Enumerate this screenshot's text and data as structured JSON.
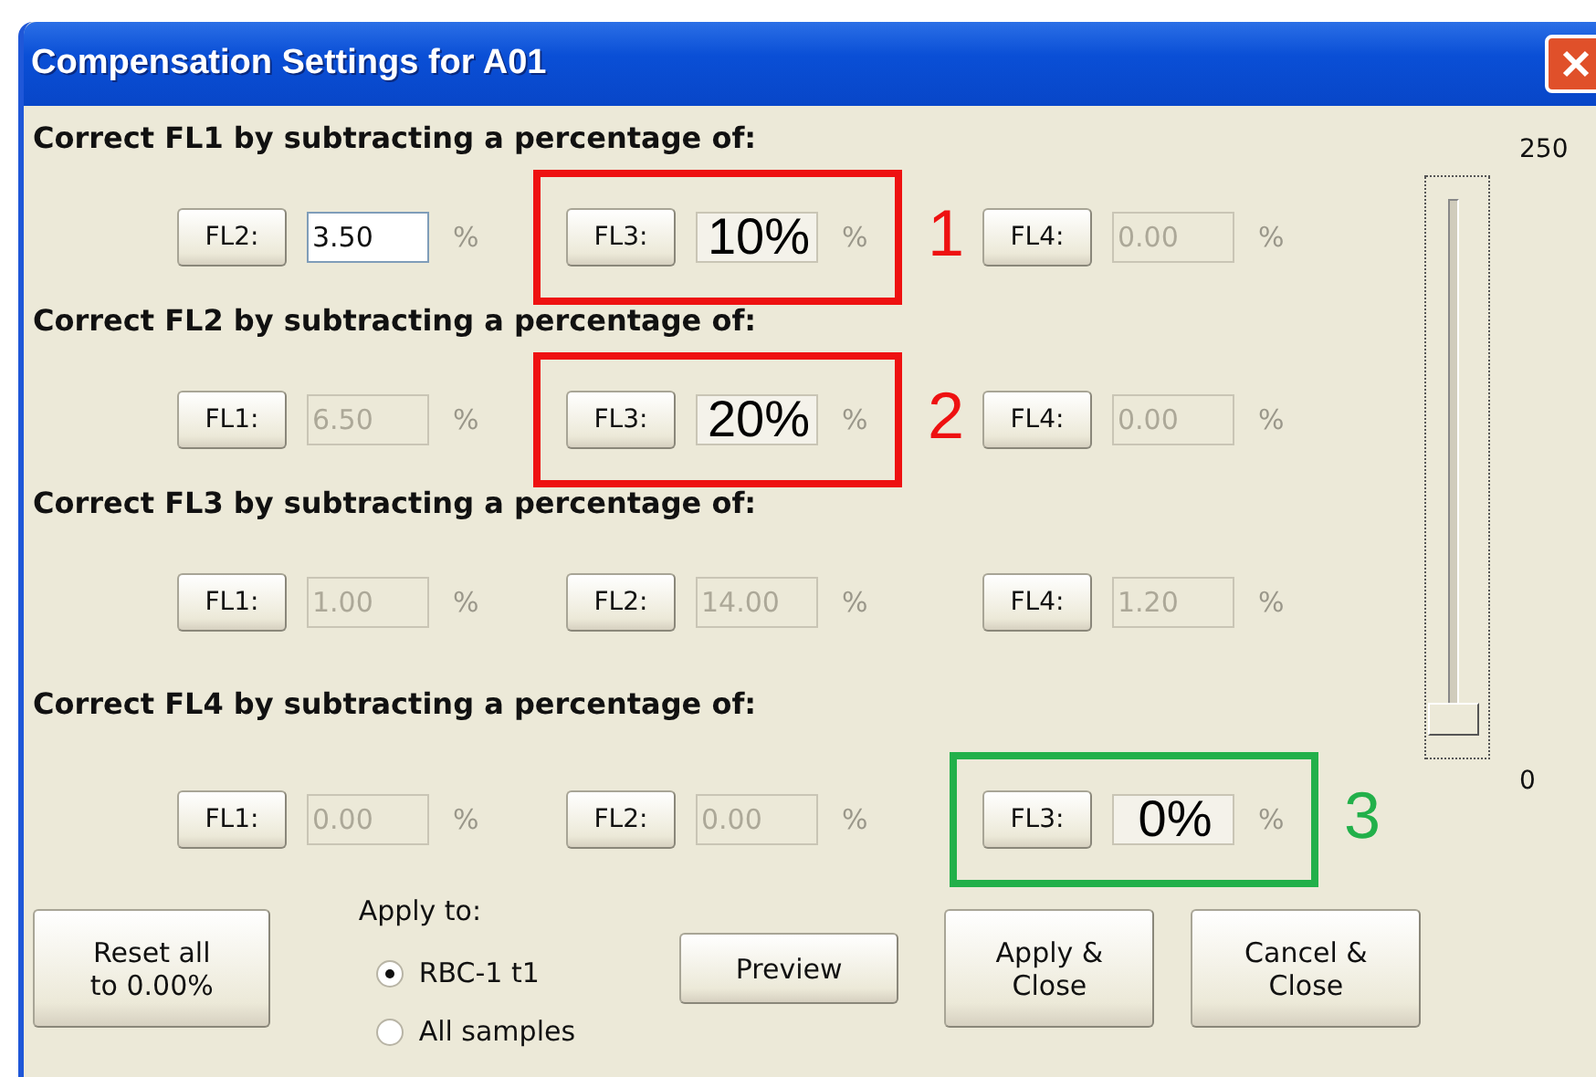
{
  "window": {
    "title": "Compensation Settings for A01"
  },
  "sections": [
    {
      "heading": "Correct FL1 by subtracting a percentage of:",
      "items": [
        {
          "button": "FL2:",
          "value": "3.50",
          "unit": "%",
          "disabled": false
        },
        {
          "button": "FL3:",
          "value": "10%",
          "unit": "%",
          "disabled": true,
          "annotation": {
            "label": "1",
            "color": "#ee1111"
          }
        },
        {
          "button": "FL4:",
          "value": "0.00",
          "unit": "%",
          "disabled": true
        }
      ]
    },
    {
      "heading": "Correct FL2 by subtracting a percentage of:",
      "items": [
        {
          "button": "FL1:",
          "value": "6.50",
          "unit": "%",
          "disabled": true
        },
        {
          "button": "FL3:",
          "value": "20%",
          "unit": "%",
          "disabled": true,
          "annotation": {
            "label": "2",
            "color": "#ee1111"
          }
        },
        {
          "button": "FL4:",
          "value": "0.00",
          "unit": "%",
          "disabled": true
        }
      ]
    },
    {
      "heading": "Correct FL3 by subtracting a percentage of:",
      "items": [
        {
          "button": "FL1:",
          "value": "1.00",
          "unit": "%",
          "disabled": true
        },
        {
          "button": "FL2:",
          "value": "14.00",
          "unit": "%",
          "disabled": true
        },
        {
          "button": "FL4:",
          "value": "1.20",
          "unit": "%",
          "disabled": true
        }
      ]
    },
    {
      "heading": "Correct FL4 by subtracting a percentage of:",
      "items": [
        {
          "button": "FL1:",
          "value": "0.00",
          "unit": "%",
          "disabled": true
        },
        {
          "button": "FL2:",
          "value": "0.00",
          "unit": "%",
          "disabled": true
        },
        {
          "button": "FL3:",
          "value": "0%",
          "unit": "%",
          "disabled": true,
          "annotation": {
            "label": "3",
            "color": "#22b04a"
          }
        }
      ]
    }
  ],
  "slider": {
    "max_label": "250",
    "min_label": "0",
    "level": 0
  },
  "reset_button": "Reset all\nto 0.00%",
  "apply_to": {
    "label": "Apply to:",
    "options": [
      {
        "label": "RBC-1 t1",
        "selected": true
      },
      {
        "label": "All samples",
        "selected": false
      }
    ]
  },
  "preview_button": "Preview",
  "apply_button": "Apply &\nClose",
  "cancel_button": "Cancel &\nClose"
}
